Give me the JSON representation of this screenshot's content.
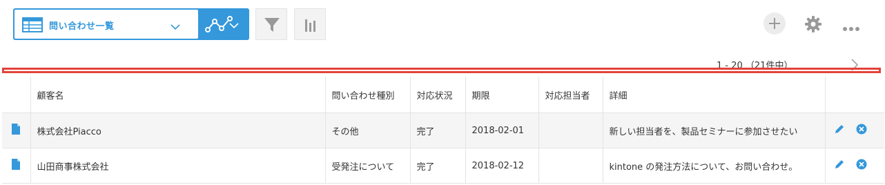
{
  "toolbar": {
    "view_name": "問い合わせ一覧",
    "view_icon": "table-icon",
    "graph_icon": "graph-icon",
    "filter_icon": "funnel-icon",
    "chart_icon": "bar-chart-icon",
    "add_icon": "plus-icon",
    "settings_icon": "gear-icon",
    "more_icon": "more-dots-icon",
    "accent_color": "#3498db"
  },
  "pagination": {
    "range_text": "1 - 20 （21件中）"
  },
  "highlight": {
    "color": "#e2423a"
  },
  "table": {
    "columns": [
      "顧客名",
      "問い合わせ種別",
      "対応状況",
      "期限",
      "対応担当者",
      "詳細"
    ],
    "rows": [
      {
        "customer": "株式会社Piacco",
        "type": "その他",
        "status": "完了",
        "deadline": "2018-02-01",
        "assignee": "",
        "detail": "新しい担当者を、製品セミナーに参加させたい"
      },
      {
        "customer": "山田商事株式会社",
        "type": "受発注について",
        "status": "完了",
        "deadline": "2018-02-12",
        "assignee": "",
        "detail": "kintone の発注方法について、お問い合わせ。"
      }
    ]
  }
}
